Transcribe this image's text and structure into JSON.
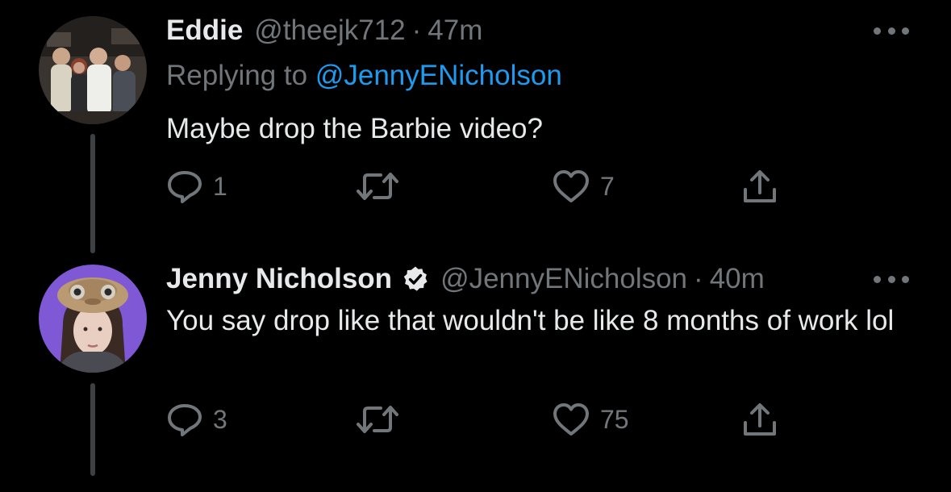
{
  "tweets": [
    {
      "name": "Eddie",
      "handle": "@theejk712",
      "separator": "·",
      "time": "47m",
      "replying_prefix": "Replying to ",
      "replying_to": "@JennyENicholson",
      "text": "Maybe drop the Barbie video?",
      "reply_count": "1",
      "retweet_count": "",
      "like_count": "7",
      "verified": false,
      "avatar_icon": "group-photo-avatar"
    },
    {
      "name": "Jenny Nicholson",
      "handle": "@JennyENicholson",
      "separator": "·",
      "time": "40m",
      "text": "You say drop like that wouldn't be like 8 months of work lol",
      "reply_count": "3",
      "retweet_count": "",
      "like_count": "75",
      "verified": true,
      "avatar_icon": "et-hat-avatar"
    }
  ],
  "colors": {
    "background": "#000000",
    "primary_text": "#e7e9ea",
    "secondary_text": "#71767b",
    "link": "#1d9bf0",
    "thread_line": "#3e4144"
  },
  "icons": {
    "reply": "reply-icon",
    "retweet": "retweet-icon",
    "like": "heart-icon",
    "share": "share-icon",
    "more": "more-options-icon",
    "verified": "verified-badge-icon"
  }
}
